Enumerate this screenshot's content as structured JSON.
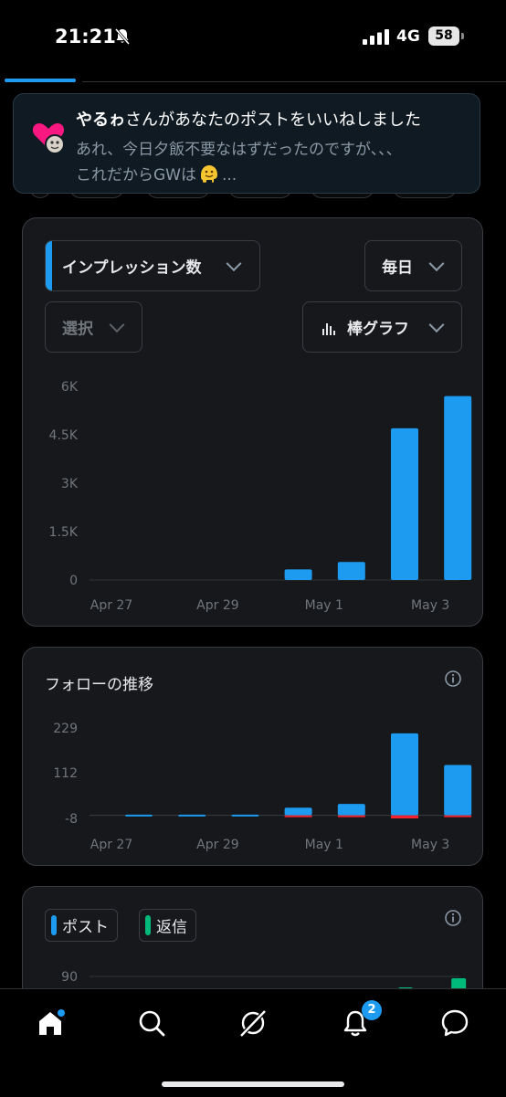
{
  "status_bar": {
    "time": "21:21",
    "network": "4G",
    "battery": "58"
  },
  "notification": {
    "user": "やるゎ",
    "message": "さんがあなたのポストをいいねしました",
    "body_line1": "あれ、今日夕飯不要なはずだったのですが、、、",
    "body_line2_prefix": "これだからGWは",
    "body_line2_suffix": "..."
  },
  "impressions_card": {
    "metric_label": "インプレッション数",
    "period_label": "毎日",
    "select_placeholder": "選択",
    "chart_type_label": "棒グラフ"
  },
  "follower_card": {
    "title": "フォローの推移"
  },
  "posts_card": {
    "legend_post": "ポスト",
    "legend_reply": "返信"
  },
  "nav": {
    "notification_count": "2"
  },
  "colors": {
    "accent": "#1d9bf0",
    "negative": "#f4212e",
    "reply": "#00ba7c"
  },
  "chart_data": [
    {
      "type": "bar",
      "categories": [
        "Apr 27",
        "Apr 28",
        "Apr 29",
        "Apr 30",
        "May 1",
        "May 2",
        "May 3"
      ],
      "x_tick_labels": [
        "Apr 27",
        "Apr 29",
        "May 1",
        "May 3"
      ],
      "y_tick_labels": [
        "6K",
        "4.5K",
        "3K",
        "1.5K",
        "0"
      ],
      "values": [
        0,
        0,
        0,
        330,
        560,
        4700,
        5700
      ],
      "ylim": [
        0,
        6000
      ]
    },
    {
      "type": "bar",
      "categories": [
        "Apr 27",
        "Apr 28",
        "Apr 29",
        "Apr 30",
        "May 1",
        "May 2",
        "May 3"
      ],
      "x_tick_labels": [
        "Apr 27",
        "Apr 29",
        "May 1",
        "May 3"
      ],
      "y_tick_labels": [
        "229",
        "112",
        "-8"
      ],
      "series": [
        {
          "values": [
            2,
            2,
            2,
            20,
            30,
            215,
            132
          ]
        },
        {
          "values": [
            0,
            0,
            0,
            -2,
            -2,
            -8,
            -4
          ]
        }
      ],
      "ylim": [
        -8,
        229
      ]
    },
    {
      "type": "bar",
      "y_tick_labels": [
        "90"
      ],
      "series": [
        {
          "name": "返信",
          "values": [
            0,
            0,
            0,
            0,
            0,
            20,
            30
          ]
        }
      ]
    }
  ]
}
